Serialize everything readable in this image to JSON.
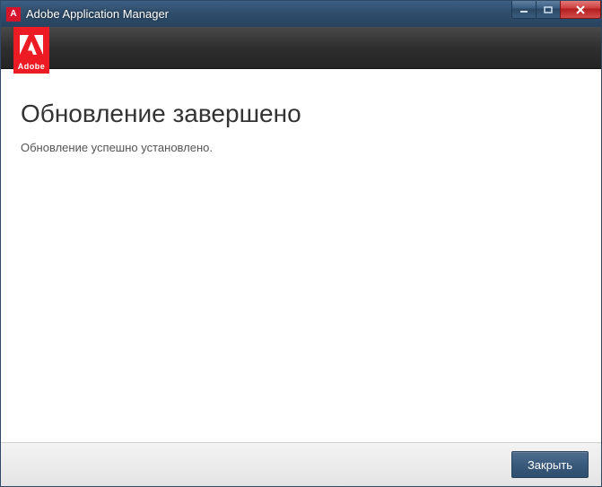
{
  "window": {
    "title": "Adobe Application Manager"
  },
  "brand": {
    "short": "A",
    "name": "Adobe"
  },
  "content": {
    "heading": "Обновление завершено",
    "message": "Обновление успешно установлено."
  },
  "footer": {
    "close_label": "Закрыть"
  }
}
